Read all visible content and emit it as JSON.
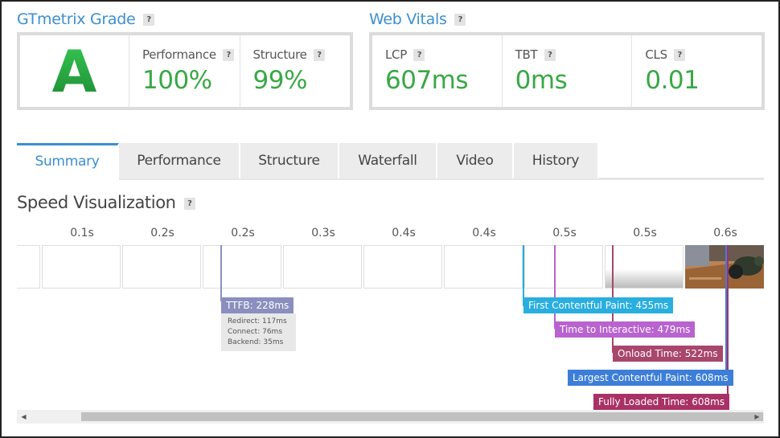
{
  "grade_section": {
    "title": "GTmetrix Grade",
    "help": "?",
    "grade": "A",
    "metrics": [
      {
        "label": "Performance",
        "value": "100%"
      },
      {
        "label": "Structure",
        "value": "99%"
      }
    ]
  },
  "vitals_section": {
    "title": "Web Vitals",
    "help": "?",
    "metrics": [
      {
        "label": "LCP",
        "value": "607ms"
      },
      {
        "label": "TBT",
        "value": "0ms"
      },
      {
        "label": "CLS",
        "value": "0.01"
      }
    ]
  },
  "tabs": [
    {
      "label": "Summary",
      "active": true
    },
    {
      "label": "Performance"
    },
    {
      "label": "Structure"
    },
    {
      "label": "Waterfall"
    },
    {
      "label": "Video"
    },
    {
      "label": "History"
    }
  ],
  "speed_visualization": {
    "title": "Speed Visualization",
    "help": "?",
    "ticks": [
      "0.1s",
      "0.2s",
      "0.2s",
      "0.3s",
      "0.4s",
      "0.4s",
      "0.5s",
      "0.5s",
      "0.6s"
    ],
    "ttfb": {
      "label": "TTFB: 228ms",
      "details": [
        "Redirect: 117ms",
        "Connect: 76ms",
        "Backend: 35ms"
      ]
    },
    "markers": [
      {
        "label": "First Contentful Paint: 455ms",
        "color": "#29aee0"
      },
      {
        "label": "Time to Interactive: 479ms",
        "color": "#b863cf"
      },
      {
        "label": "Onload Time: 522ms",
        "color": "#a8466b"
      },
      {
        "label": "Largest Contentful Paint: 608ms",
        "color": "#3d7ed8"
      },
      {
        "label": "Fully Loaded Time: 608ms",
        "color": "#a83166"
      }
    ],
    "ttfb_color": "#8a8fbe"
  },
  "scrollbar": {
    "left_arrow": "◀",
    "right_arrow": "▶"
  }
}
